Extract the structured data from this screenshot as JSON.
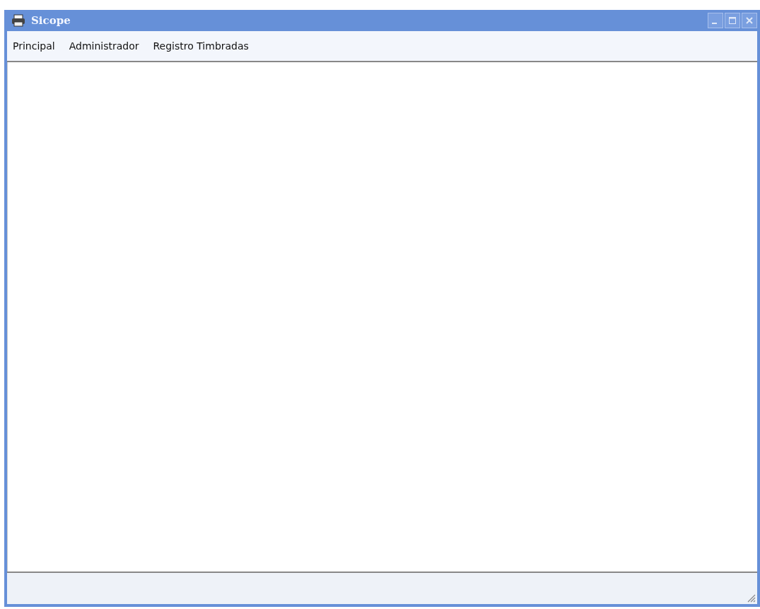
{
  "window": {
    "title": "Sicope"
  },
  "menu": [
    {
      "label": "Principal"
    },
    {
      "label": "Administrador"
    },
    {
      "label": "Registro Timbradas"
    }
  ]
}
